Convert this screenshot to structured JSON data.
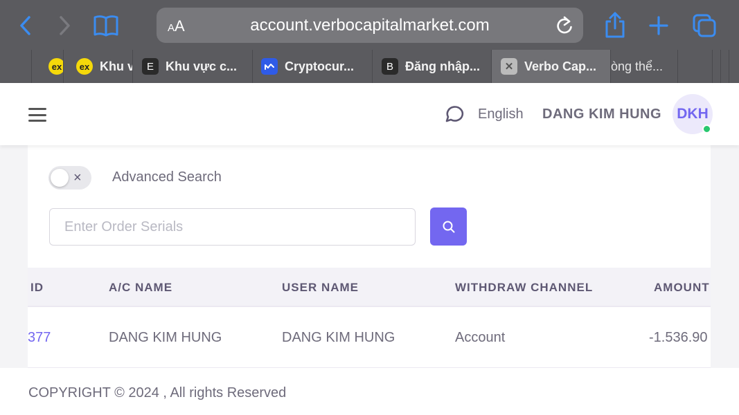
{
  "browser": {
    "text_size_label_small": "A",
    "text_size_label_large": "A",
    "url": "account.verbocapitalmarket.com",
    "tabs": [
      {
        "favicon": "ex",
        "label": "Khu v"
      },
      {
        "favicon": "E",
        "label": "Khu vực c..."
      },
      {
        "favicon": "coinmarketcap-icon",
        "label": "Cryptocur..."
      },
      {
        "favicon": "B",
        "label": "Đăng nhập..."
      },
      {
        "favicon": "close-icon",
        "label": "Verbo Cap..."
      },
      {
        "favicon": "",
        "label": "òng thể..."
      }
    ]
  },
  "header": {
    "language": "English",
    "user_name": "DANG KIM HUNG",
    "avatar_initials": "DKH"
  },
  "search": {
    "advanced_label": "Advanced Search",
    "advanced_enabled": false,
    "toggle_off_glyph": "×",
    "placeholder": "Enter Order Serials",
    "value": ""
  },
  "table": {
    "columns": [
      "ID",
      "A/C NAME",
      "USER NAME",
      "WITHDRAW CHANNEL",
      "AMOUNT"
    ],
    "rows": [
      {
        "id": "377",
        "ac_name": "DANG KIM HUNG",
        "user_name": "DANG KIM HUNG",
        "channel": "Account",
        "amount": "-1.536.90"
      }
    ]
  },
  "footer": {
    "copyright": "COPYRIGHT © 2024 , All rights Reserved"
  },
  "colors": {
    "accent": "#7367f0",
    "online": "#28c76f",
    "toolbar": "#5b5b5f",
    "safari_blue": "#3b8cf0"
  }
}
